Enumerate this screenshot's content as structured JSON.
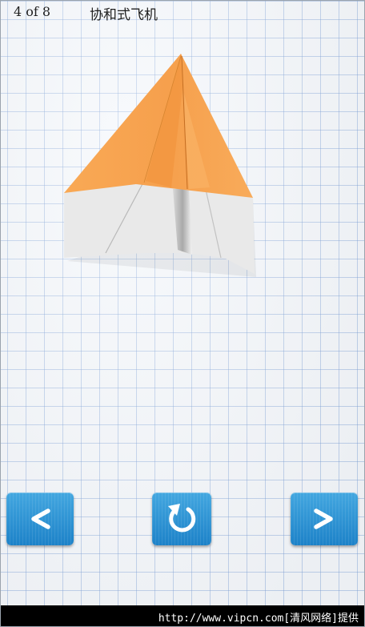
{
  "header": {
    "step_counter": "4 of 8",
    "title": "协和式飞机"
  },
  "illustration": {
    "subject": "paper-airplane-fold-step",
    "colors": {
      "paper_back": "#f7a04e",
      "paper_front": "#e9e9e9"
    }
  },
  "controls": {
    "previous_icon": "chevron-left-icon",
    "restart_icon": "restart-icon",
    "next_icon": "chevron-right-icon",
    "button_color": "#2a90d2"
  },
  "watermark": {
    "text": "http://www.vipcn.com[清风网络]提供"
  }
}
